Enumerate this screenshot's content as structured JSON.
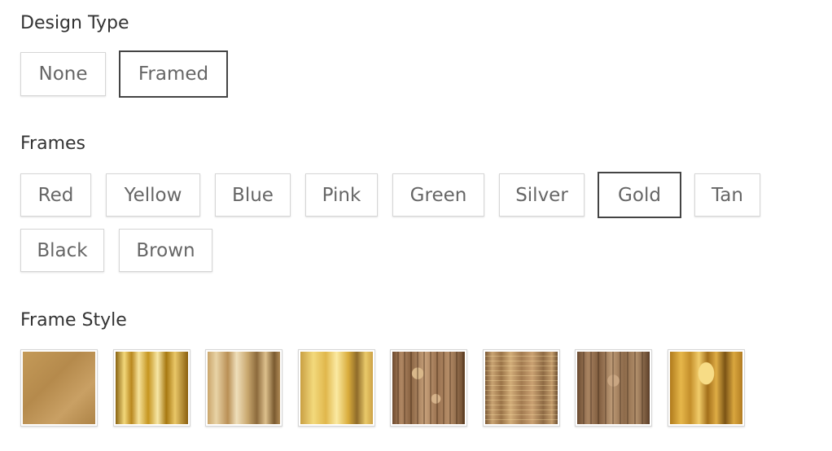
{
  "design_type": {
    "title": "Design Type",
    "options": [
      {
        "label": "None",
        "selected": false
      },
      {
        "label": "Framed",
        "selected": true
      }
    ]
  },
  "frames": {
    "title": "Frames",
    "options": [
      {
        "label": "Red",
        "selected": false
      },
      {
        "label": "Yellow",
        "selected": false
      },
      {
        "label": "Blue",
        "selected": false
      },
      {
        "label": "Pink",
        "selected": false
      },
      {
        "label": "Green",
        "selected": false
      },
      {
        "label": "Silver",
        "selected": false
      },
      {
        "label": "Gold",
        "selected": true
      },
      {
        "label": "Tan",
        "selected": false
      },
      {
        "label": "Black",
        "selected": false
      },
      {
        "label": "Brown",
        "selected": false
      }
    ]
  },
  "frame_style": {
    "title": "Frame Style",
    "swatches": [
      {
        "texture": "matte-gold"
      },
      {
        "texture": "polished-gold-stripes"
      },
      {
        "texture": "antique-gold-woodgrain"
      },
      {
        "texture": "bright-gold"
      },
      {
        "texture": "ornate-bronze-scroll"
      },
      {
        "texture": "beaded-bronze"
      },
      {
        "texture": "ornate-bronze-carved"
      },
      {
        "texture": "rustic-gold-leaf"
      }
    ]
  },
  "colors": {
    "selected_border": "#444444",
    "default_border": "#d6d6d6",
    "text": "#666666"
  }
}
